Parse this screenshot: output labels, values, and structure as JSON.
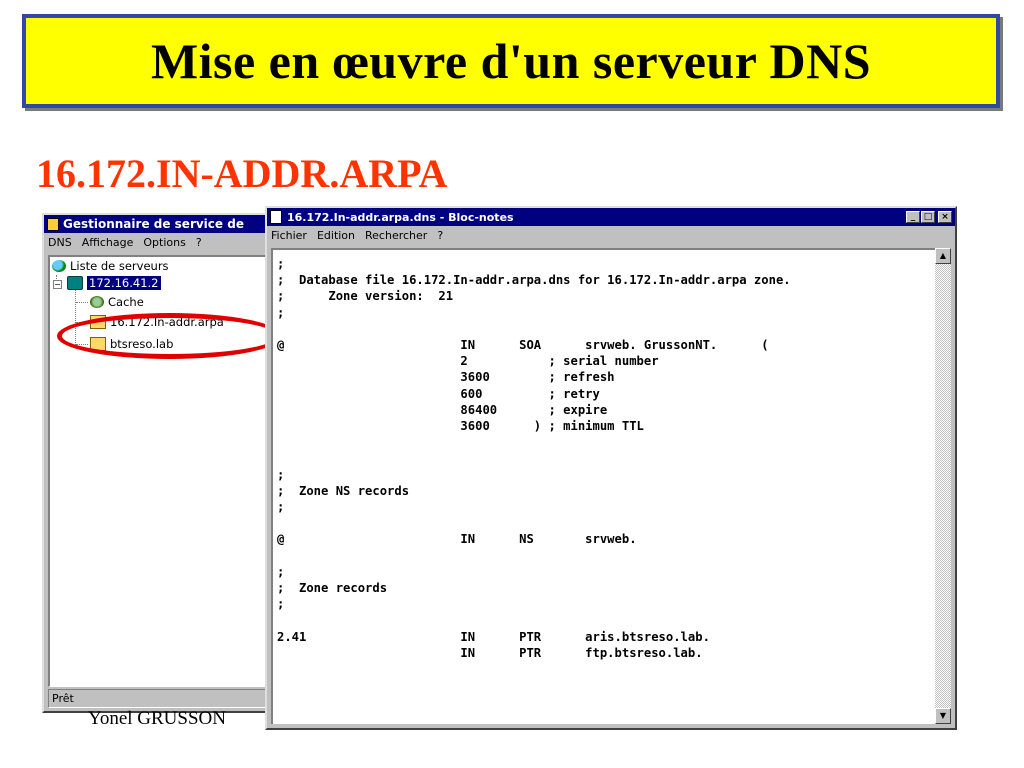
{
  "slide": {
    "title": "Mise en œuvre d'un serveur DNS",
    "subtitle": "16.172.IN-ADDR.ARPA",
    "author": "Yonel GRUSSON",
    "colors": {
      "banner": "#ffff00",
      "banner_border": "#2f4aa0",
      "subtitle": "#ff3300",
      "annotation": "#e00000"
    }
  },
  "dns_manager": {
    "title": "Gestionnaire de service de",
    "menu": [
      "DNS",
      "Affichage",
      "Options",
      "?"
    ],
    "tree": {
      "root": "Liste de serveurs",
      "server": "172.16.41.2",
      "children": [
        "Cache",
        "16.172.In-addr.arpa",
        "btsreso.lab"
      ]
    },
    "status": "Prêt"
  },
  "notepad": {
    "title": "16.172.In-addr.arpa.dns - Bloc-notes",
    "menu": [
      "Fichier",
      "Edition",
      "Rechercher",
      "?"
    ],
    "buttons": {
      "minimize": "_",
      "maximize": "□",
      "close": "×"
    },
    "lines": [
      ";",
      ";  Database file 16.172.In-addr.arpa.dns for 16.172.In-addr.arpa zone.",
      ";      Zone version:  21",
      ";",
      "",
      "@                        IN      SOA      srvweb. GrussonNT.      (",
      "                         2           ; serial number",
      "                         3600        ; refresh",
      "                         600         ; retry",
      "                         86400       ; expire",
      "                         3600      ) ; minimum TTL",
      "",
      "",
      ";",
      ";  Zone NS records",
      ";",
      "",
      "@                        IN      NS       srvweb.",
      "",
      ";",
      ";  Zone records",
      ";",
      "",
      "2.41                     IN      PTR      aris.btsreso.lab.",
      "                         IN      PTR      ftp.btsreso.lab."
    ]
  }
}
